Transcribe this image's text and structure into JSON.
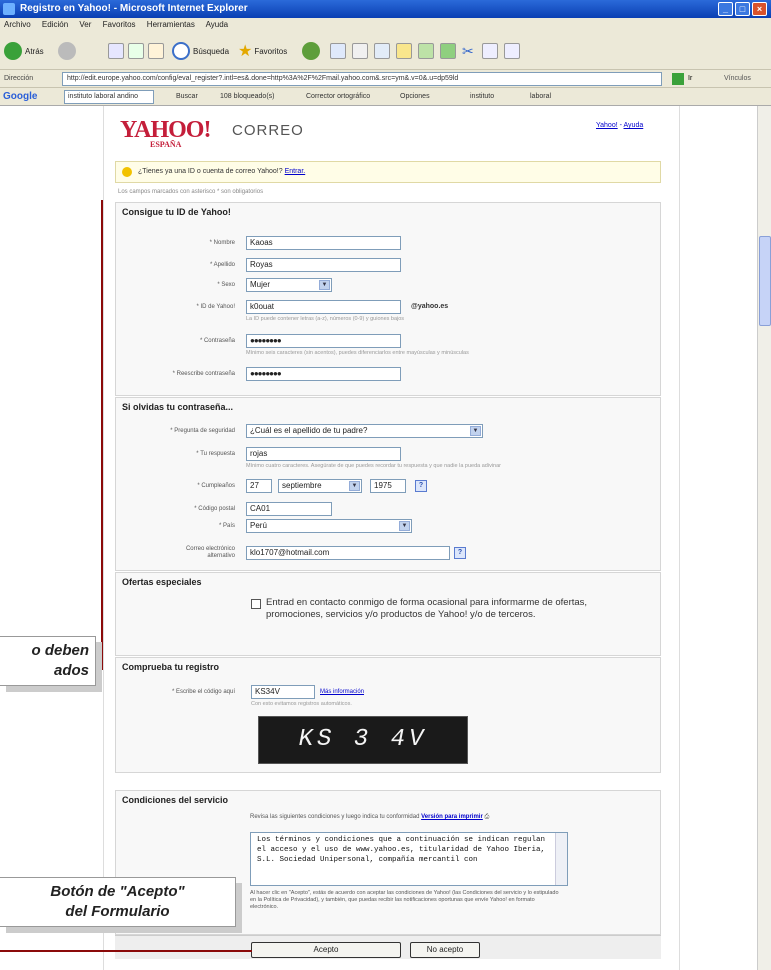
{
  "window": {
    "title": "Registro en Yahoo! - Microsoft Internet Explorer"
  },
  "menu": [
    "Archivo",
    "Edición",
    "Ver",
    "Favoritos",
    "Herramientas",
    "Ayuda"
  ],
  "toolbar": {
    "back": "Atrás",
    "search": "Búsqueda",
    "favorites": "Favoritos"
  },
  "addressbar": {
    "label": "Dirección",
    "url": "http://edit.europe.yahoo.com/config/eval_register?.intl=es&.done=http%3A%2F%2Fmail.yahoo.com&.src=ym&.v=0&.u=dp59ld",
    "go": "Ir",
    "links": "Vínculos"
  },
  "googlebar": {
    "logo": "Google",
    "query": "instituto laboral andino",
    "search": "Buscar",
    "blocked": "108 bloqueado(s)",
    "spell": "Corrector ortográfico",
    "options": "Opciones",
    "instituto": "instituto",
    "laboral": "laboral"
  },
  "header": {
    "logo": "YAHOO!",
    "logo_sub": "ESPAÑA",
    "product": "CORREO",
    "link_yahoo": "Yahoo!",
    "link_help": "Ayuda"
  },
  "notice": {
    "text": "¿Tienes ya una ID o cuenta de correo Yahoo!?",
    "link": "Entrar."
  },
  "required_note": "Los campos marcados con asterisco * son obligatorios",
  "sections": {
    "id": "Consigue tu ID de Yahoo!",
    "password": "Si olvidas tu contraseña...",
    "offers": "Ofertas especiales",
    "verify": "Comprueba tu registro",
    "terms": "Condiciones del servicio"
  },
  "form": {
    "nombre_label": "* Nombre",
    "nombre": "Kaoas",
    "apellido_label": "* Apellido",
    "apellido": "Royas",
    "sexo_label": "* Sexo",
    "sexo": "Mujer",
    "yid_label": "* ID de Yahoo!",
    "yid": "k0ouat",
    "domain": "@yahoo.es",
    "yid_hint": "La ID puede contener letras (a-z), números (0-9) y guiones bajos",
    "pwd_label": "* Contraseña",
    "pwd": "●●●●●●●●",
    "pwd_hint": "Mínimo seis caracteres (sin acentos), puedes diferenciarlos entre mayúsculas y minúsculas",
    "pwd2_label": "* Reescribe contraseña",
    "pwd2": "●●●●●●●●",
    "question_label": "* Pregunta de seguridad",
    "question": "¿Cuál es el apellido de tu padre?",
    "answer_label": "* Tu respuesta",
    "answer": "rojas",
    "answer_hint": "Mínimo cuatro caracteres. Asegúrate de que puedes recordar tu respuesta y que nadie la pueda adivinar",
    "birth_label": "* Cumpleaños",
    "birth_day": "27",
    "birth_month": "septiembre",
    "birth_year": "1975",
    "zip_label": "* Código postal",
    "zip": "CA01",
    "country_label": "* País",
    "country": "Perú",
    "altmail_label": "Correo electrónico alternativo",
    "altmail": "klo1707@hotmail.com",
    "offers_text": "Entrad en contacto conmigo de forma ocasional para informarme de ofertas, promociones, servicios y/o productos de Yahoo! y/o de terceros.",
    "code_label": "* Escribe el código aquí",
    "code": "KS34V",
    "code_link": "Más información",
    "code_hint": "Con esto evitamos registros automáticos.",
    "captcha": "KS 3 4V",
    "terms_intro": "Revisa las siguientes condiciones y luego indica tu conformidad",
    "terms_print": "Versión para imprimir",
    "terms_text": "Los términos y condiciones que a continuación se indican regulan el acceso y el uso de www.yahoo.es, titularidad de Yahoo Iberia, S.L. Sociedad Unipersonal, compañía mercantil con",
    "terms_accept_note": "Al hacer clic en \"Acepto\", estás de acuerdo con aceptar las condiciones de Yahoo! (las Condiciones del servicio y lo estipulado en la Política de Privacidad), y también, que puedas recibir las notificaciones oportunas que envíe Yahoo! en formato electrónico.",
    "accept": "Acepto",
    "decline": "No acepto"
  },
  "callouts": {
    "fields": "o deben\nados",
    "accept": "Botón de \"Acepto\"\ndel Formulario"
  }
}
